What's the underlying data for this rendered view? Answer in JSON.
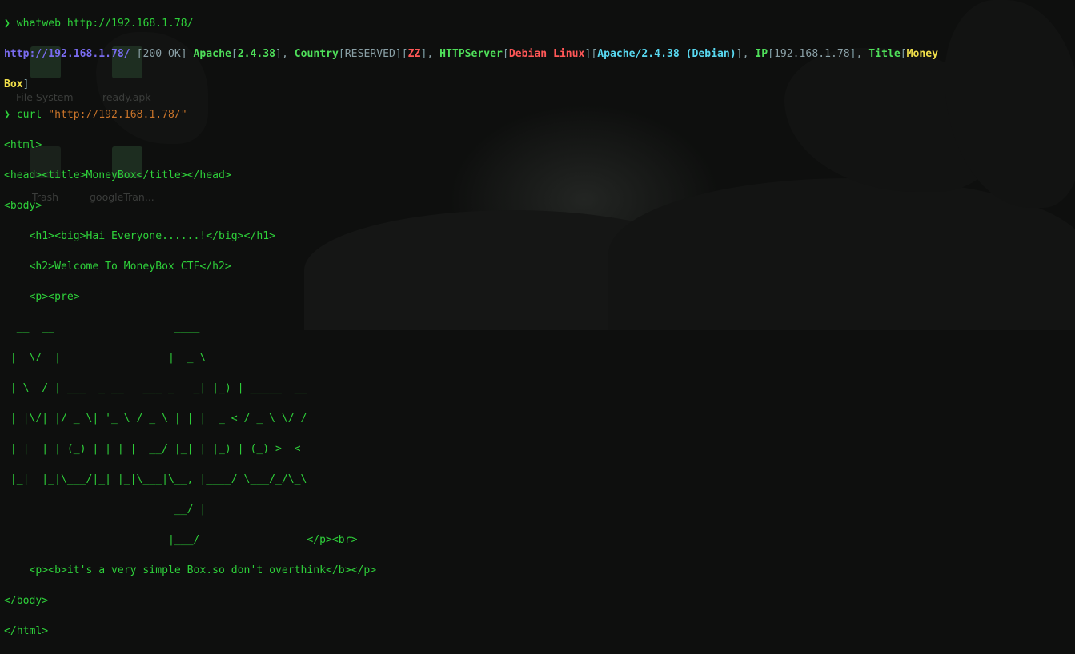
{
  "terminal": {
    "prompt_symbol": "❯",
    "cmd1": {
      "name": "whatweb",
      "arg": "http://192.168.1.78/"
    },
    "whatweb": {
      "url": "http://192.168.1.78/",
      "status": "[200 OK]",
      "apache_key": "Apache",
      "apache_val": "2.4.38",
      "country_key": "Country",
      "country_val1": "RESERVED",
      "country_val2": "ZZ",
      "httpserver_key": "HTTPServer",
      "httpserver_val1": "Debian Linux",
      "httpserver_val2": "Apache/2.4.38 (Debian)",
      "ip_key": "IP",
      "ip_val": "192.168.1.78",
      "title_key": "Title",
      "title_val_a": "Money",
      "title_val_b": "Box"
    },
    "cmd2": {
      "name": "curl",
      "arg": "\"http://192.168.1.78/\""
    },
    "html_lines": [
      "<html>",
      "<head><title>MoneyBox</title></head>",
      "<body>",
      "    <h1><big>Hai Everyone......!</big></h1>",
      "    <h2>Welcome To MoneyBox CTF</h2>",
      "    <p><pre>",
      "  __  __                   ____",
      " |  \\/  |                 |  _ \\",
      " | \\  / | ___  _ __   ___ _   _| |_) | _____  __",
      " | |\\/| |/ _ \\| '_ \\ / _ \\ | | |  _ < / _ \\ \\/ /",
      " | |  | | (_) | | | |  __/ |_| | |_) | (_) >  <",
      " |_|  |_|\\___/|_| |_|\\___|\\__, |____/ \\___/_/\\_\\",
      "                           __/ |",
      "                          |___/                 </p><br>",
      "    <p><b>it's a very simple Box.so don't overthink</b></p>",
      "</body>",
      "</html>"
    ]
  },
  "desktop_ghosts": {
    "system_label": "File System",
    "apk_label": "ready.apk",
    "trash_label": "Trash",
    "google_label": "googleTran..."
  }
}
